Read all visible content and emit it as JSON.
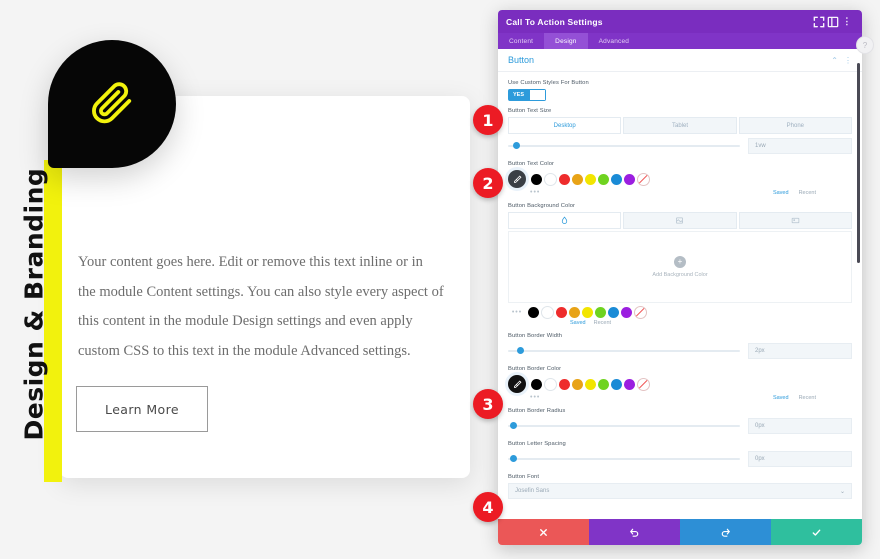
{
  "preview": {
    "vertical_label": "Design & Branding",
    "logo_icon": "paperclip-icon",
    "body_text": "Your content goes here. Edit or remove this text inline or in the module Content settings. You can also style every aspect of this content in the module Design settings and even apply custom CSS to this text in the module Advanced settings.",
    "button_label": "Learn More",
    "accent_yellow": "#f2f20d",
    "blob_color": "#060606"
  },
  "markers": [
    {
      "number": "1"
    },
    {
      "number": "2"
    },
    {
      "number": "3"
    },
    {
      "number": "4"
    }
  ],
  "panel": {
    "title": "Call To Action Settings",
    "title_icons": [
      "expand-icon",
      "layout-icon",
      "kebab-menu-icon"
    ],
    "tabs": [
      {
        "label": "Content",
        "active": false
      },
      {
        "label": "Design",
        "active": true
      },
      {
        "label": "Advanced",
        "active": false
      }
    ],
    "section": {
      "title": "Button",
      "collapse_icon": "chevron-up-icon",
      "options_icon": "kebab-menu-icon"
    },
    "fields": {
      "use_custom_styles": {
        "label": "Use Custom Styles For Button",
        "value": "YES"
      },
      "button_text_size": {
        "label": "Button Text Size",
        "devices": [
          {
            "label": "Desktop",
            "active": true
          },
          {
            "label": "Tablet",
            "active": false
          },
          {
            "label": "Phone",
            "active": false
          }
        ],
        "value": "1vw",
        "slider_pct": 2
      },
      "button_text_color": {
        "label": "Button Text Color"
      },
      "button_background_color": {
        "label": "Button Background Color",
        "bg_tabs": [
          {
            "icon": "color-icon",
            "active": true
          },
          {
            "icon": "gradient-icon",
            "active": false
          },
          {
            "icon": "image-icon",
            "active": false
          }
        ],
        "dropzone_text": "Add Background Color",
        "dropzone_icon": "plus-icon"
      },
      "button_border_width": {
        "label": "Button Border Width",
        "value": "2px",
        "slider_pct": 4
      },
      "button_border_color": {
        "label": "Button Border Color"
      },
      "button_border_radius": {
        "label": "Button Border Radius",
        "value": "0px",
        "slider_pct": 1
      },
      "button_letter_spacing": {
        "label": "Button Letter Spacing",
        "value": "0px",
        "slider_pct": 1
      },
      "button_font": {
        "label": "Button Font",
        "value": "Josefin Sans",
        "chevron": "chevron-down-icon"
      }
    },
    "palette_labels": {
      "saved": "Saved",
      "recent": "Recent",
      "more": "•••"
    },
    "swatches": [
      {
        "name": "black",
        "hex": "#000000"
      },
      {
        "name": "white",
        "hex": "#ffffff"
      },
      {
        "name": "red",
        "hex": "#ee2c2c"
      },
      {
        "name": "orange",
        "hex": "#e8a317"
      },
      {
        "name": "yellow",
        "hex": "#f2e500"
      },
      {
        "name": "green",
        "hex": "#6fd320"
      },
      {
        "name": "blue",
        "hex": "#1a8bd6"
      },
      {
        "name": "purple",
        "hex": "#9b1ee0"
      },
      {
        "name": "none",
        "hex": "transparent"
      }
    ],
    "actions": [
      {
        "name": "cancel-button",
        "icon": "x-icon",
        "color": "#eb5757"
      },
      {
        "name": "undo-button",
        "icon": "undo-icon",
        "color": "#8034c7"
      },
      {
        "name": "redo-button",
        "icon": "redo-icon",
        "color": "#2d8fd6"
      },
      {
        "name": "save-button",
        "icon": "check-icon",
        "color": "#2fbf9e"
      }
    ]
  }
}
